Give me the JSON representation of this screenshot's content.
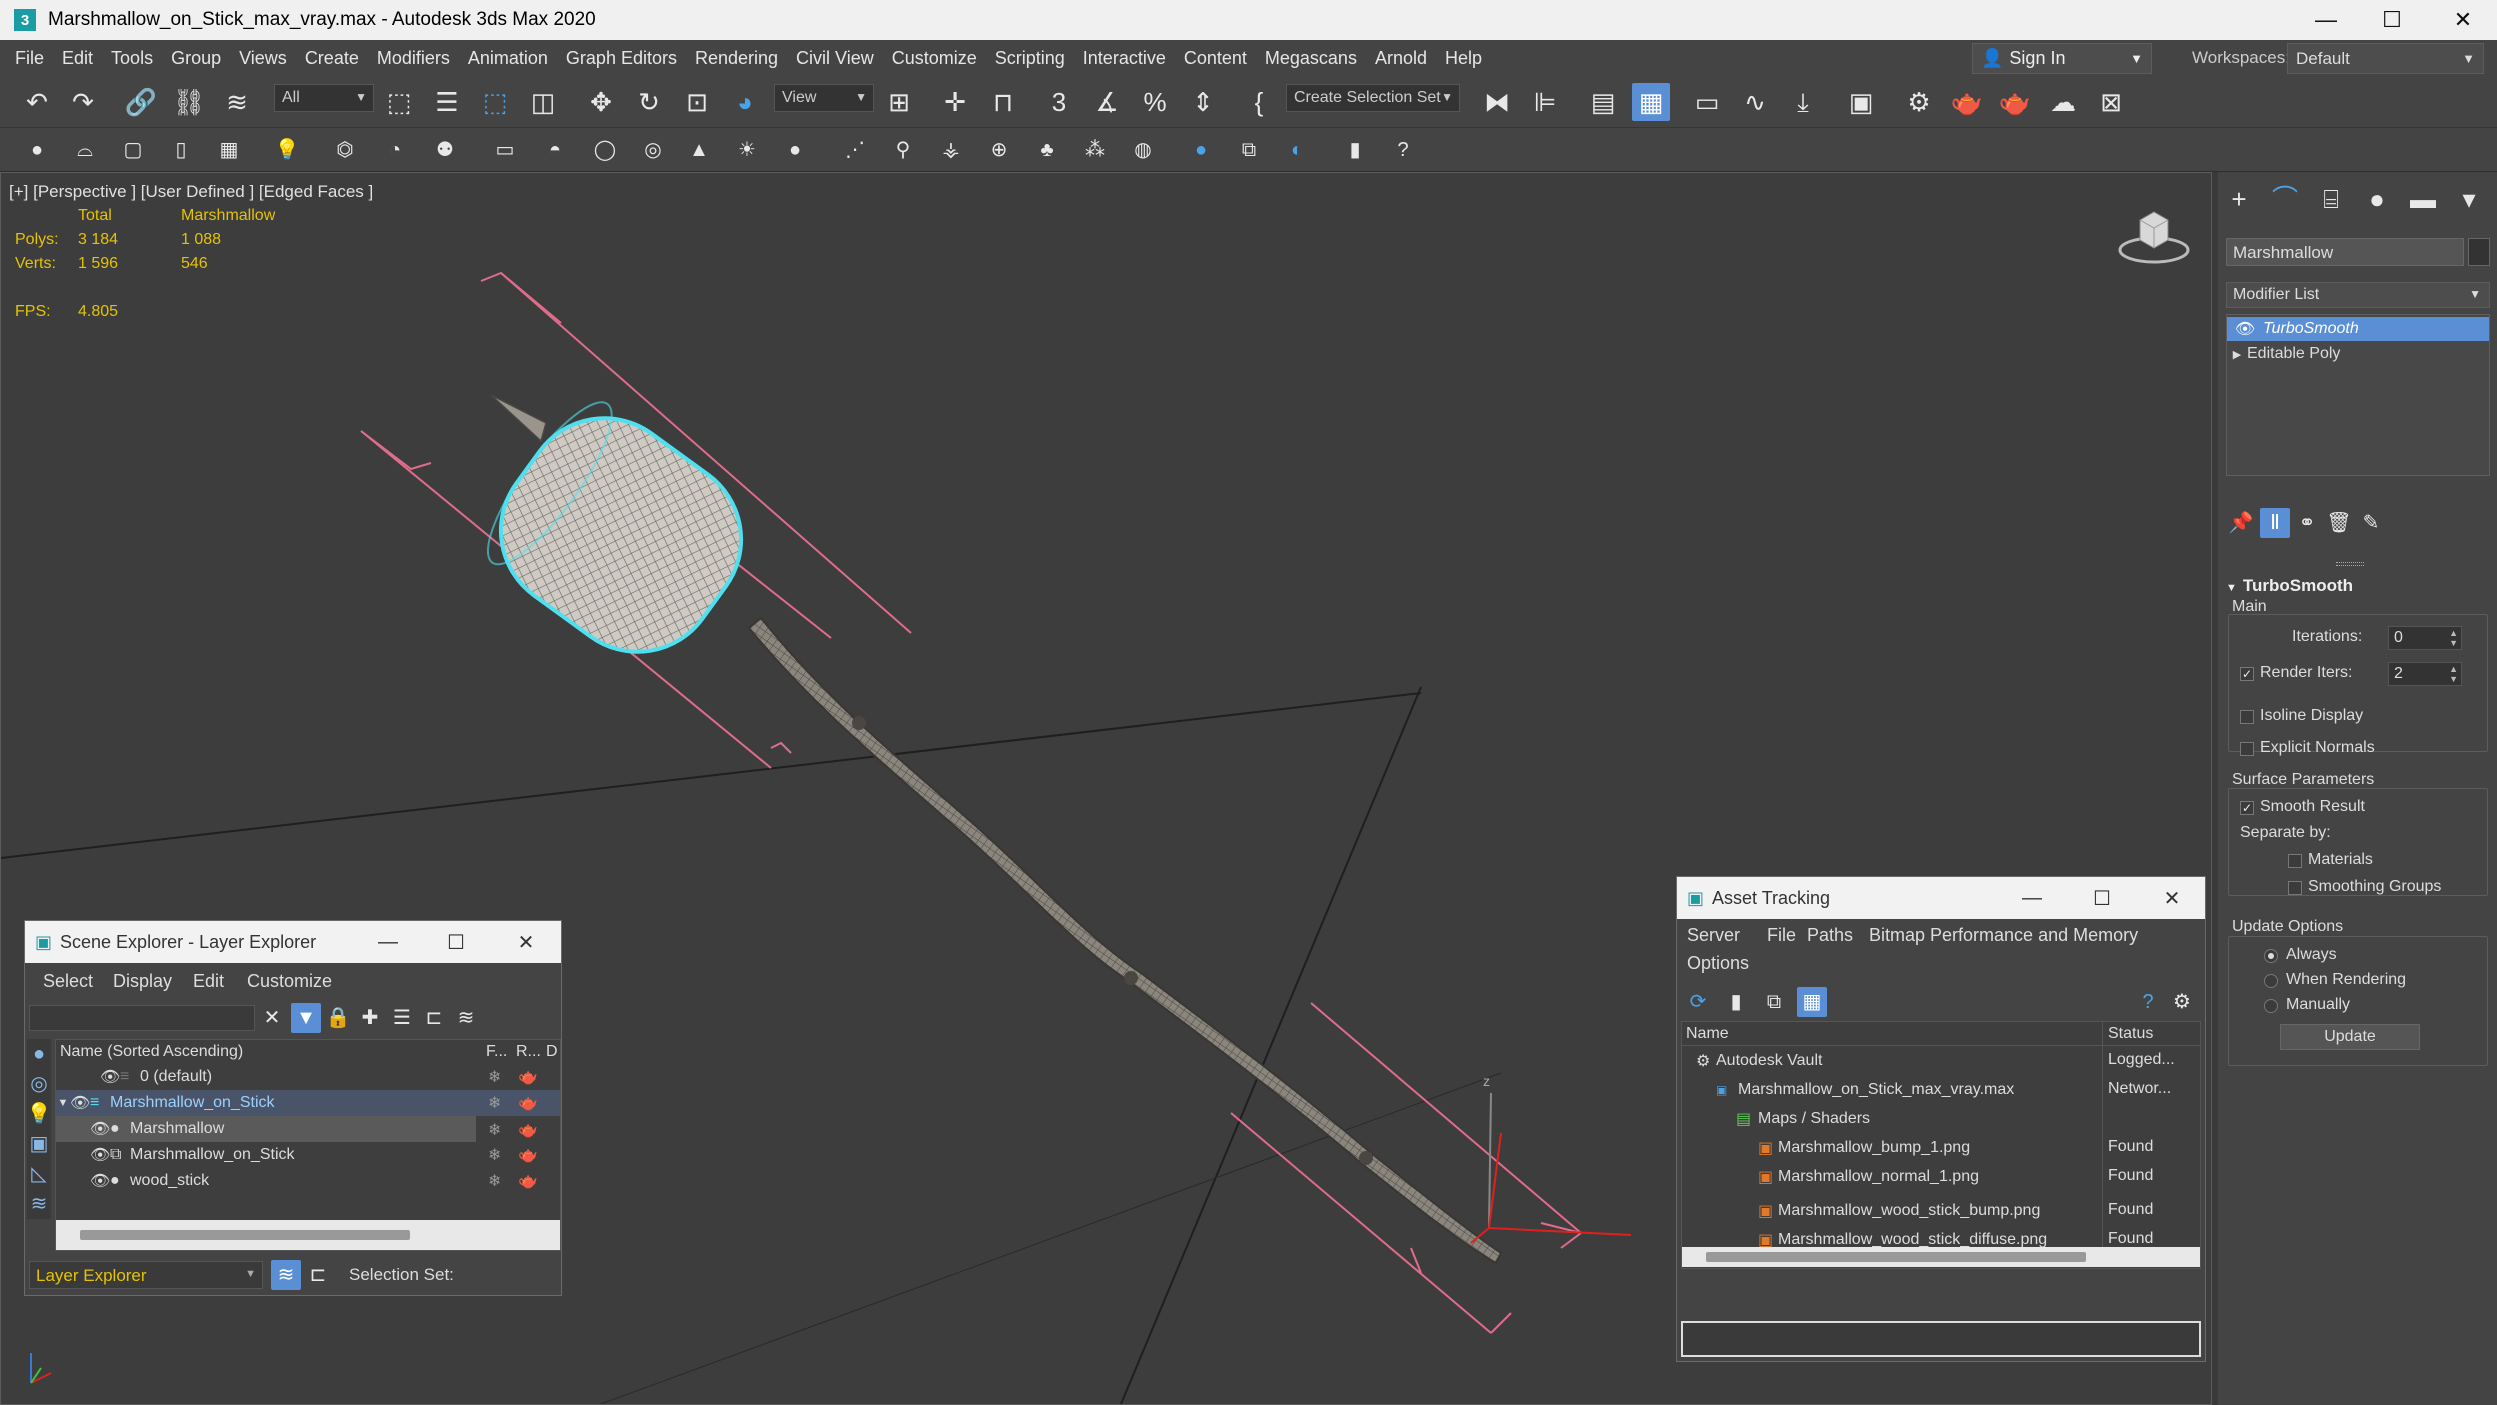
{
  "window": {
    "title": "Marshmallow_on_Stick_max_vray.max - Autodesk 3ds Max 2020",
    "minimize": "—",
    "maximize": "☐",
    "close": "✕"
  },
  "menu": [
    "File",
    "Edit",
    "Tools",
    "Group",
    "Views",
    "Create",
    "Modifiers",
    "Animation",
    "Graph Editors",
    "Rendering",
    "Civil View",
    "Customize",
    "Scripting",
    "Interactive",
    "Content",
    "Megascans",
    "Arnold",
    "Help"
  ],
  "signin": "Sign In",
  "workspaces": {
    "label": "Workspaces:",
    "value": "Default"
  },
  "toolbar": {
    "selection_filter": "All",
    "reference_coord": "View",
    "create_selection_set": "Create Selection Set"
  },
  "viewport": {
    "label": "[+] [Perspective ] [User Defined ] [Edged Faces ]",
    "stats": {
      "col_total": "Total",
      "col_object": "Marshmallow",
      "polys_label": "Polys:",
      "polys_total": "3 184",
      "polys_object": "1 088",
      "verts_label": "Verts:",
      "verts_total": "1 596",
      "verts_object": "546",
      "fps_label": "FPS:",
      "fps_value": "4.805"
    },
    "axis_z": "z"
  },
  "command_panel": {
    "object_name": "Marshmallow",
    "modifier_list": "Modifier List",
    "stack": [
      "TurboSmooth",
      "Editable Poly"
    ],
    "rollout": {
      "title": "TurboSmooth",
      "main": "Main",
      "iterations_label": "Iterations:",
      "iterations_value": "0",
      "render_iters_label": "Render Iters:",
      "render_iters_value": "2",
      "render_iters_checked": true,
      "isoline_display": "Isoline Display",
      "explicit_normals": "Explicit Normals",
      "surface_params": "Surface Parameters",
      "smooth_result": "Smooth Result",
      "separate_by": "Separate by:",
      "materials": "Materials",
      "smoothing_groups": "Smoothing Groups",
      "update_options": "Update Options",
      "always": "Always",
      "when_rendering": "When Rendering",
      "manually": "Manually",
      "update_button": "Update"
    }
  },
  "scene_explorer": {
    "title": "Scene Explorer - Layer Explorer",
    "menu": [
      "Select",
      "Display",
      "Edit",
      "Customize"
    ],
    "columns": {
      "name": "Name (Sorted Ascending)",
      "f": "F...",
      "r": "R...",
      "d": "D"
    },
    "rows": [
      {
        "name": "0 (default)",
        "indent": 0
      },
      {
        "name": "Marshmallow_on_Stick",
        "indent": 0
      },
      {
        "name": "Marshmallow",
        "indent": 1
      },
      {
        "name": "Marshmallow_on_Stick",
        "indent": 1
      },
      {
        "name": "wood_stick",
        "indent": 1
      }
    ],
    "footer_drop": "Layer Explorer",
    "selection_set": "Selection Set:"
  },
  "asset_tracking": {
    "title": "Asset Tracking",
    "menu": [
      "Server",
      "File",
      "Paths",
      "Bitmap Performance and Memory"
    ],
    "menu2": "Options",
    "columns": {
      "name": "Name",
      "status": "Status"
    },
    "rows": [
      {
        "name": "Autodesk Vault",
        "status": "Logged...",
        "indent": 0
      },
      {
        "name": "Marshmallow_on_Stick_max_vray.max",
        "status": "Networ...",
        "indent": 1
      },
      {
        "name": "Maps / Shaders",
        "status": "",
        "indent": 2
      },
      {
        "name": "Marshmallow_bump_1.png",
        "status": "Found",
        "indent": 3
      },
      {
        "name": "Marshmallow_normal_1.png",
        "status": "Found",
        "indent": 3
      },
      {
        "name": "Marshmallow_wood_stick_bump.png",
        "status": "Found",
        "indent": 3
      },
      {
        "name": "Marshmallow_wood_stick_diffuse.png",
        "status": "Found",
        "indent": 3
      }
    ]
  },
  "colors": {
    "selection_blue": "#5a8fd6",
    "stat_yellow": "#e5c300",
    "highlight_cyan": "#4fe0f0",
    "bbox_pink": "#e06c8c"
  }
}
